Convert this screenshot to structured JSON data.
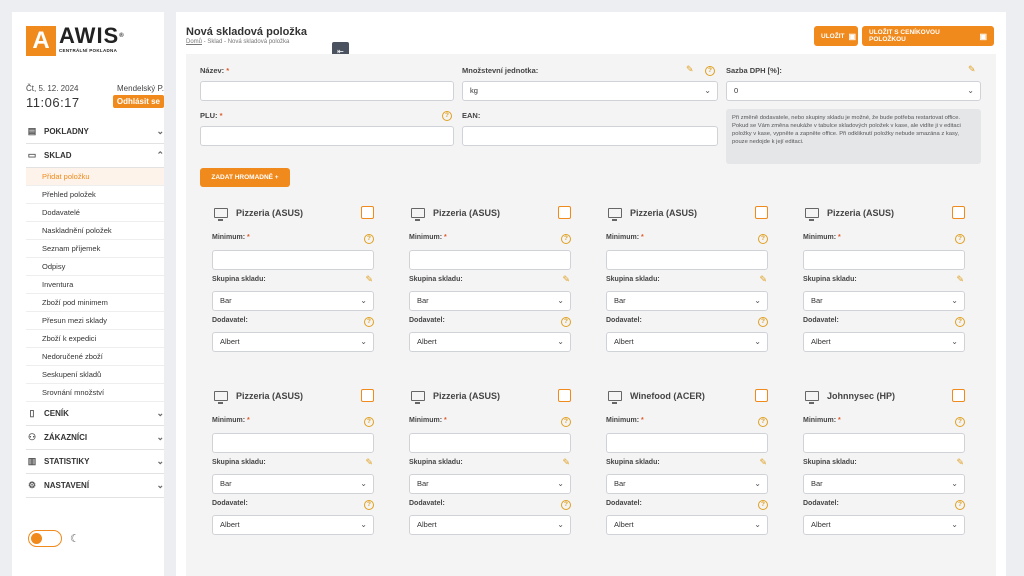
{
  "sidebar": {
    "logo_name": "AWIS",
    "logo_sub": "CENTRÁLNÍ POKLADNA",
    "date": "Čt, 5. 12. 2024",
    "user": "Mendelský P.",
    "clock": "11:06:17",
    "logout_label": "Odhlásit se",
    "nav": [
      {
        "label": "POKLADNY",
        "icon": "register-icon"
      },
      {
        "label": "SKLAD",
        "icon": "box-icon"
      },
      {
        "label": "CENÍK",
        "icon": "file-icon"
      },
      {
        "label": "ZÁKAZNÍCI",
        "icon": "users-icon"
      },
      {
        "label": "STATISTIKY",
        "icon": "chart-icon"
      },
      {
        "label": "NASTAVENÍ",
        "icon": "gear-icon"
      }
    ],
    "sklad_items": [
      "Přidat položku",
      "Přehled položek",
      "Dodavatelé",
      "Naskladnění položek",
      "Seznam příjemek",
      "Odpisy",
      "Inventura",
      "Zboží pod minimem",
      "Přesun mezi sklady",
      "Zboží k expedici",
      "Nedoručené zboží",
      "Seskupení skladů",
      "Srovnání množství"
    ]
  },
  "header": {
    "title": "Nová skladová položka",
    "crumb_home": "Domů",
    "crumb_rest": " - Sklad - Nová skladová položka",
    "save_label": "ULOŽIT",
    "save_price_label": "ULOŽIT S CENÍKOVOU POLOŽKOU"
  },
  "form": {
    "name_label": "Název:",
    "unit_label": "Množstevní jednotka:",
    "unit_value": "kg",
    "vat_label": "Sazba DPH [%]:",
    "vat_value": "0",
    "plu_label": "PLU:",
    "ean_label": "EAN:",
    "note": "Při změně dodavatele, nebo skupiny skladu je možné, že bude potřeba restartovat office. Pokud se Vám změna neukáže v tabulce skladových položek v kase, ale vidíte ji v editaci položky v kase, vypněte a zapněte office. Při odkliknutí položky nebude smazána z kasy, pouze nedojde k její editaci.",
    "bulk_label": "ZADAT HROMADNĚ +"
  },
  "card_labels": {
    "minimum": "Minimum:",
    "group": "Skupina skladu:",
    "supplier": "Dodavatel:"
  },
  "cards": [
    {
      "name": "Pizzeria (ASUS)",
      "group": "Bar",
      "supplier": "Albert"
    },
    {
      "name": "Pizzeria (ASUS)",
      "group": "Bar",
      "supplier": "Albert"
    },
    {
      "name": "Pizzeria (ASUS)",
      "group": "Bar",
      "supplier": "Albert"
    },
    {
      "name": "Pizzeria (ASUS)",
      "group": "Bar",
      "supplier": "Albert"
    },
    {
      "name": "Pizzeria (ASUS)",
      "group": "Bar",
      "supplier": "Albert"
    },
    {
      "name": "Pizzeria (ASUS)",
      "group": "Bar",
      "supplier": "Albert"
    },
    {
      "name": "Winefood (ACER)",
      "group": "Bar",
      "supplier": "Albert"
    },
    {
      "name": "Johnnysec (HP)",
      "group": "Bar",
      "supplier": "Albert"
    }
  ],
  "colors": {
    "accent": "#f08a1c"
  }
}
